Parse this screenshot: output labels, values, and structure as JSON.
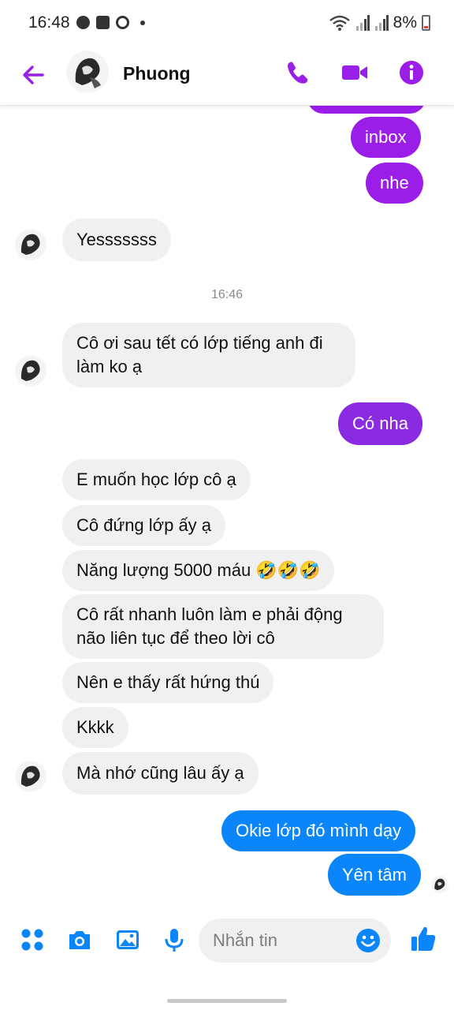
{
  "status_bar": {
    "time": "16:48",
    "battery": "8%"
  },
  "header": {
    "contact_name": "Phuong"
  },
  "colors": {
    "accent_purple": "#9b1de8",
    "accent_blue": "#0b86fa",
    "incoming_bg": "#f0f0f0"
  },
  "messages": [
    {
      "id": "m1",
      "dir": "out",
      "text": "",
      "partial": true
    },
    {
      "id": "m2",
      "dir": "out",
      "text": "inbox"
    },
    {
      "id": "m3",
      "dir": "out",
      "text": "nhe"
    },
    {
      "id": "m4",
      "dir": "in",
      "text": "Yesssssss"
    },
    {
      "id": "t1",
      "type": "timestamp",
      "text": "16:46"
    },
    {
      "id": "m5",
      "dir": "in",
      "text_line1": "Cô ơi sau tết có lớp tiếng anh đi",
      "text_line2": "làm ko ạ"
    },
    {
      "id": "m6",
      "dir": "out",
      "text": "Có nha"
    },
    {
      "id": "m7",
      "dir": "in",
      "text": "E muốn học lớp cô ạ"
    },
    {
      "id": "m8",
      "dir": "in",
      "text": "Cô đứng lớp ấy ạ"
    },
    {
      "id": "m9",
      "dir": "in",
      "text": "Năng lượng 5000 máu 🤣🤣🤣"
    },
    {
      "id": "m10",
      "dir": "in",
      "text_line1": "Cô rất nhanh luôn làm e phải động",
      "text_line2": "não liên tục để theo lời cô"
    },
    {
      "id": "m11",
      "dir": "in",
      "text": "Nên e thấy rất hứng thú"
    },
    {
      "id": "m12",
      "dir": "in",
      "text": "Kkkk"
    },
    {
      "id": "m13",
      "dir": "in",
      "text": "Mà nhớ cũng lâu ấy ạ"
    },
    {
      "id": "m14",
      "dir": "out",
      "text": "Okie lớp đó mình dạy"
    },
    {
      "id": "m15",
      "dir": "out",
      "text": "Yên tâm"
    }
  ],
  "composer": {
    "placeholder": "Nhắn tin"
  },
  "icons": [
    "back-arrow-icon",
    "phone-icon",
    "video-camera-icon",
    "info-icon",
    "apps-grid-icon",
    "camera-icon",
    "image-icon",
    "microphone-icon",
    "emoji-icon",
    "thumbs-up-icon"
  ]
}
